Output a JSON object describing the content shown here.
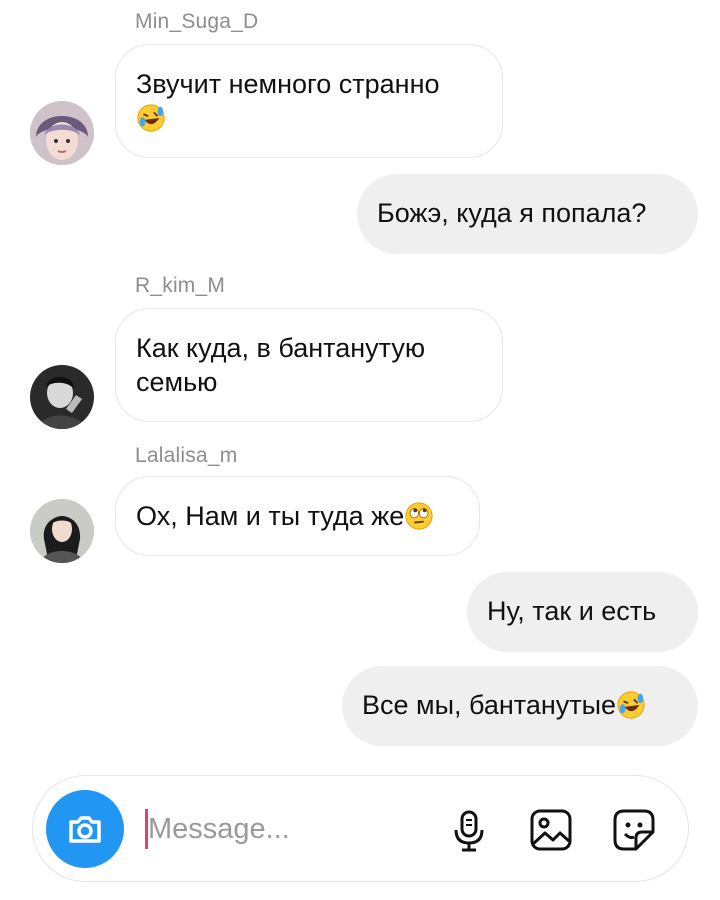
{
  "messages": [
    {
      "sender": "Min_Suga_D",
      "lines": [
        "Звучит немного странно"
      ],
      "emoji": "rofl-emoji"
    },
    {
      "text": "Божэ, куда я попала?"
    },
    {
      "sender": "R_kim_M",
      "lines": [
        "Как куда, в бантанутую",
        "семью"
      ]
    },
    {
      "sender": "Lalalisa_m",
      "text": "Ох, Нам и ты туда же",
      "emoji": "eye-roll-emoji"
    },
    {
      "text": "Ну, так и есть"
    },
    {
      "text": "Все мы, бантанутые",
      "emoji": "rofl-emoji"
    }
  ],
  "composer": {
    "placeholder": "Message...",
    "icons": [
      "camera-icon",
      "microphone-icon",
      "gallery-icon",
      "sticker-icon"
    ]
  },
  "colors": {
    "accent": "#2196f3",
    "outgoing_bubble": "#efefef",
    "incoming_border": "#e6e6e6",
    "sender_name": "#8e8e8e",
    "caret": "#e4406e"
  }
}
